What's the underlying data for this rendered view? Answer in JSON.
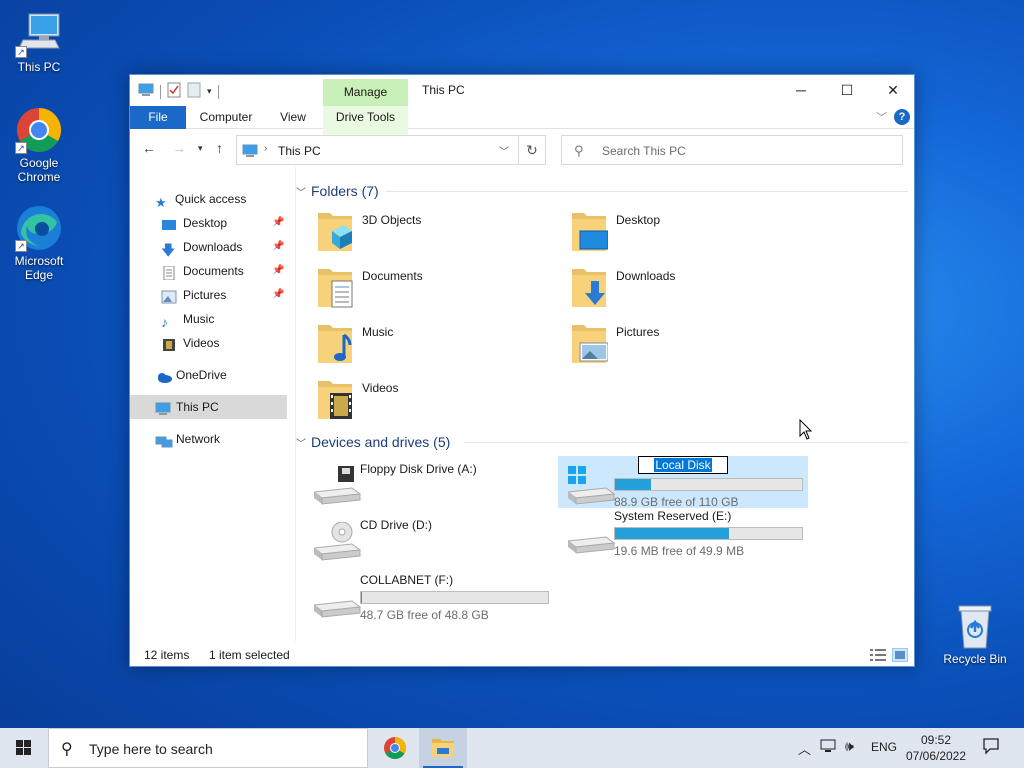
{
  "desktop": {
    "icons": [
      {
        "label": "This PC"
      },
      {
        "label": "Google Chrome"
      },
      {
        "label": "Microsoft Edge"
      },
      {
        "label": "Recycle Bin"
      }
    ]
  },
  "window": {
    "title": "This PC",
    "manage_label": "Manage",
    "controls": {
      "minimize": "─",
      "maximize": "☐",
      "close": "✕"
    },
    "ribbon_tabs": [
      "File",
      "Computer",
      "View",
      "Drive Tools"
    ],
    "help": "?"
  },
  "navbar": {
    "address_text": "This PC",
    "search_placeholder": "Search This PC"
  },
  "sidebar": {
    "items": [
      {
        "label": "Quick access",
        "icon": "star-icon",
        "pinned": false
      },
      {
        "label": "Desktop",
        "icon": "desktop-icon",
        "pinned": true
      },
      {
        "label": "Downloads",
        "icon": "download-icon",
        "pinned": true
      },
      {
        "label": "Documents",
        "icon": "documents-icon",
        "pinned": true
      },
      {
        "label": "Pictures",
        "icon": "pictures-icon",
        "pinned": true
      },
      {
        "label": "Music",
        "icon": "music-icon",
        "pinned": false
      },
      {
        "label": "Videos",
        "icon": "videos-icon",
        "pinned": false
      },
      {
        "label": "OneDrive",
        "icon": "cloud-icon",
        "pinned": false
      },
      {
        "label": "This PC",
        "icon": "computer-icon",
        "pinned": false,
        "selected": true
      },
      {
        "label": "Network",
        "icon": "network-icon",
        "pinned": false
      }
    ]
  },
  "folders": {
    "header": "Folders (7)",
    "items": [
      {
        "label": "3D Objects"
      },
      {
        "label": "Desktop"
      },
      {
        "label": "Documents"
      },
      {
        "label": "Downloads"
      },
      {
        "label": "Music"
      },
      {
        "label": "Pictures"
      },
      {
        "label": "Videos"
      }
    ]
  },
  "drives": {
    "header": "Devices and drives (5)",
    "items": [
      {
        "label": "Floppy Disk Drive (A:)",
        "free": "",
        "used_fraction": null
      },
      {
        "label": "Local Disk",
        "free": "88.9 GB free of 110 GB",
        "used_fraction": 0.19,
        "renaming": true
      },
      {
        "label": "CD Drive (D:)",
        "free": "",
        "used_fraction": null
      },
      {
        "label": "System Reserved (E:)",
        "free": "19.6 MB free of 49.9 MB",
        "used_fraction": 0.61
      },
      {
        "label": "COLLABNET (F:)",
        "free": "48.7 GB free of 48.8 GB",
        "used_fraction": 0.002
      }
    ]
  },
  "status": {
    "items": "12 items",
    "selected": "1 item selected"
  },
  "taskbar": {
    "search_placeholder": "Type here to search",
    "lang": "ENG",
    "time": "09:52",
    "date": "07/06/2022"
  }
}
